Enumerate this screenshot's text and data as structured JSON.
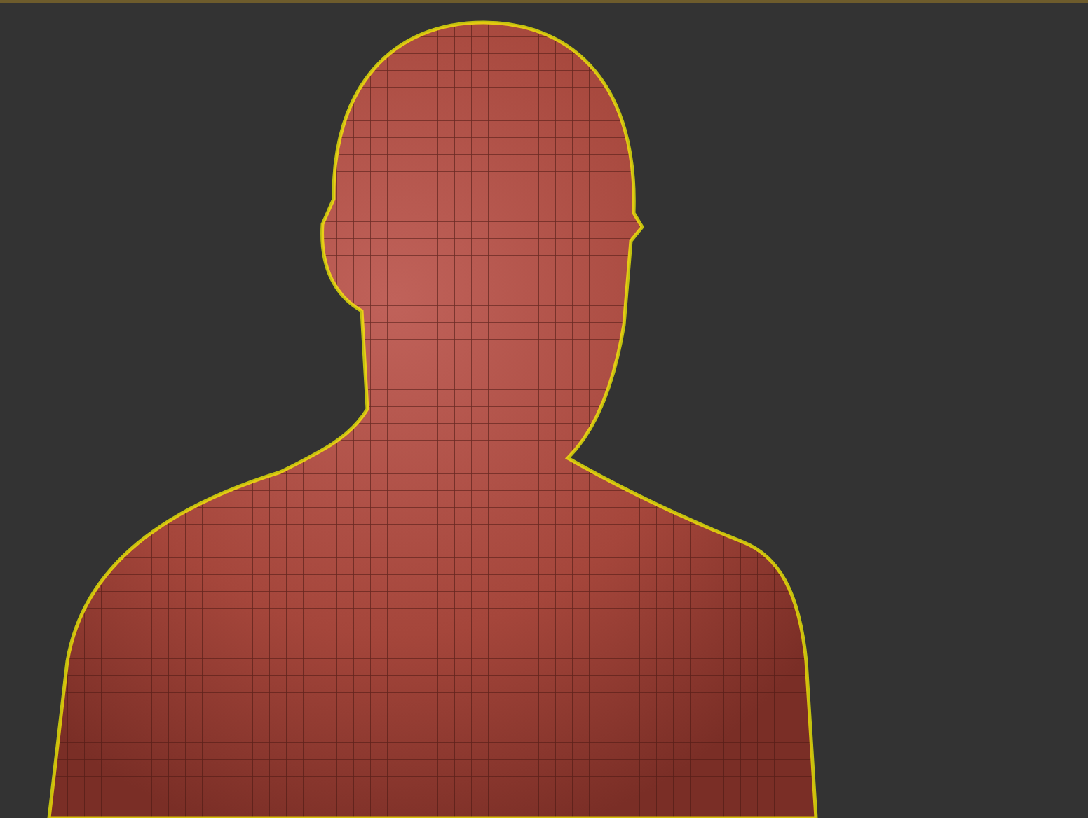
{
  "viewport": {
    "model": {
      "selected": true
    }
  }
}
